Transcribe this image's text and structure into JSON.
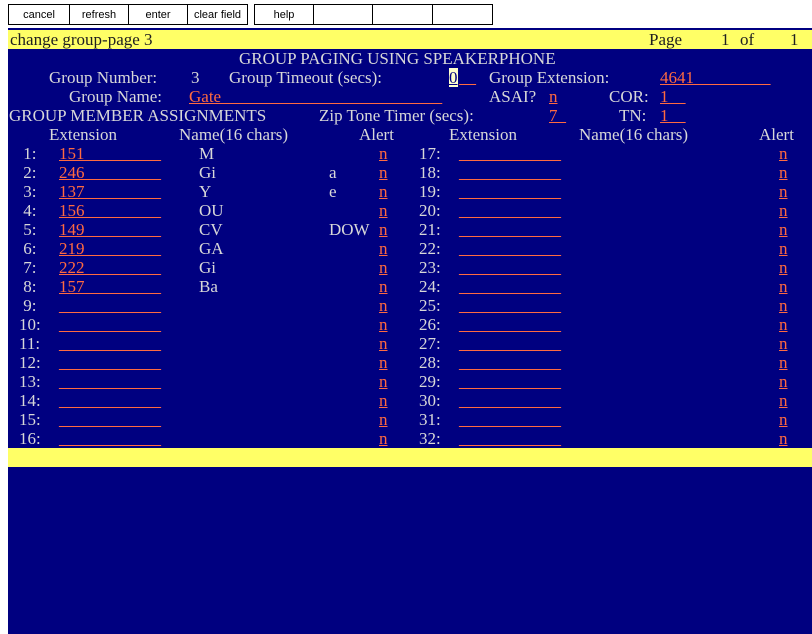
{
  "toolbar": {
    "buttons": [
      "cancel",
      "refresh",
      "enter",
      "clear field",
      "help"
    ]
  },
  "header": {
    "command": "change group-page 3",
    "page_label": "Page",
    "page_num": "1",
    "of_label": "of",
    "page_total": "1"
  },
  "form": {
    "title": "GROUP PAGING USING SPEAKERPHONE",
    "group_number_label": "Group Number:",
    "group_number": "3",
    "group_timeout_label": "Group Timeout (secs):",
    "group_timeout": "0",
    "group_timeout_pad": "__",
    "group_extension_label": "Group Extension:",
    "group_extension": "4641_________",
    "group_name_label": "Group Name:",
    "group_name": "Gate__________________________",
    "asai_label": "ASAI?",
    "asai": "n",
    "cor_label": "COR:",
    "cor": "1__",
    "section_label": "GROUP MEMBER ASSIGNMENTS",
    "zip_tone_label": "Zip Tone Timer (secs):",
    "zip_tone": "7_",
    "tn_label": "TN:",
    "tn": "1__",
    "col_extension": "Extension",
    "col_name": "Name(16 chars)",
    "col_alert": "Alert"
  },
  "members_left": [
    {
      "num": " 1:",
      "ext": "151_________",
      "name": "M",
      "alert": "n"
    },
    {
      "num": " 2:",
      "ext": "246_________",
      "name": "Gi",
      "alert": "n"
    },
    {
      "num": " 3:",
      "ext": "137_________",
      "name": "Y",
      "alert": "n"
    },
    {
      "num": " 4:",
      "ext": "156_________",
      "name": "OU",
      "alert": "n"
    },
    {
      "num": " 5:",
      "ext": "149_________",
      "name": "CV",
      "alert": "n"
    },
    {
      "num": " 6:",
      "ext": "219_________",
      "name": "GA",
      "alert": "n"
    },
    {
      "num": " 7:",
      "ext": "222_________",
      "name": "Gi",
      "alert": "n"
    },
    {
      "num": " 8:",
      "ext": "157_________",
      "name": "Ba",
      "alert": "n"
    },
    {
      "num": " 9:",
      "ext": "____________",
      "name": "",
      "alert": "n"
    },
    {
      "num": "10:",
      "ext": "____________",
      "name": "",
      "alert": "n"
    },
    {
      "num": "11:",
      "ext": "____________",
      "name": "",
      "alert": "n"
    },
    {
      "num": "12:",
      "ext": "____________",
      "name": "",
      "alert": "n"
    },
    {
      "num": "13:",
      "ext": "____________",
      "name": "",
      "alert": "n"
    },
    {
      "num": "14:",
      "ext": "____________",
      "name": "",
      "alert": "n"
    },
    {
      "num": "15:",
      "ext": "____________",
      "name": "",
      "alert": "n"
    },
    {
      "num": "16:",
      "ext": "____________",
      "name": "",
      "alert": "n"
    }
  ],
  "members_right": [
    {
      "num": "17:",
      "ext": "____________",
      "alert": "n"
    },
    {
      "num": "18:",
      "ext": "____________",
      "alert": "n"
    },
    {
      "num": "19:",
      "ext": "____________",
      "alert": "n"
    },
    {
      "num": "20:",
      "ext": "____________",
      "alert": "n"
    },
    {
      "num": "21:",
      "ext": "____________",
      "alert": "n"
    },
    {
      "num": "22:",
      "ext": "____________",
      "alert": "n"
    },
    {
      "num": "23:",
      "ext": "____________",
      "alert": "n"
    },
    {
      "num": "24:",
      "ext": "____________",
      "alert": "n"
    },
    {
      "num": "25:",
      "ext": "____________",
      "alert": "n"
    },
    {
      "num": "26:",
      "ext": "____________",
      "alert": "n"
    },
    {
      "num": "27:",
      "ext": "____________",
      "alert": "n"
    },
    {
      "num": "28:",
      "ext": "____________",
      "alert": "n"
    },
    {
      "num": "29:",
      "ext": "____________",
      "alert": "n"
    },
    {
      "num": "30:",
      "ext": "____________",
      "alert": "n"
    },
    {
      "num": "31:",
      "ext": "____________",
      "alert": "n"
    },
    {
      "num": "32:",
      "ext": "____________",
      "alert": "n"
    }
  ],
  "name_fragments": [
    {
      "text": "a"
    },
    {
      "text": "e"
    },
    {
      "text": "DOW"
    }
  ],
  "colors": {
    "screen_bg": "#000080",
    "header_bar": "#ffff66",
    "label_text": "#d8d8d8",
    "field_text": "#ff6a40"
  }
}
